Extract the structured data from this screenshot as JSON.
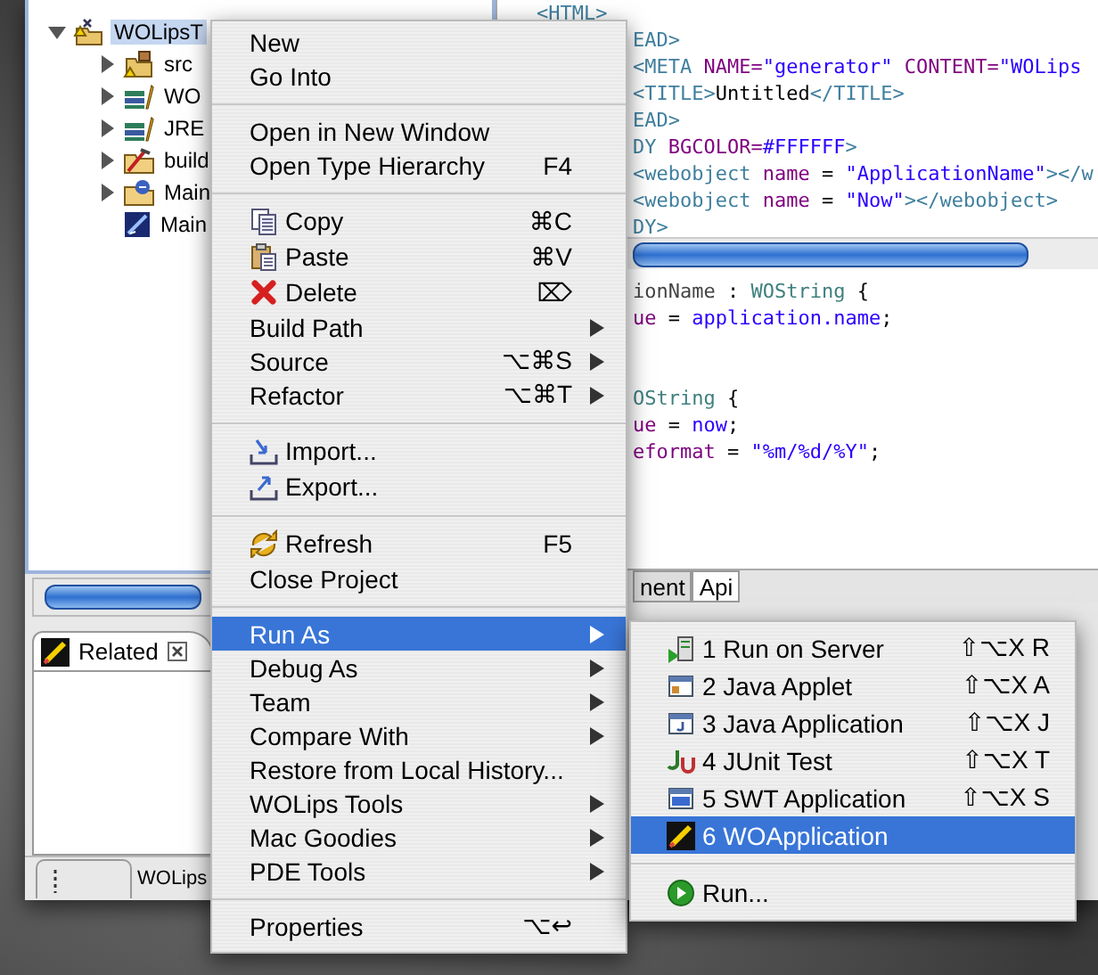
{
  "explorer": {
    "tree": {
      "label": "WOLipsT",
      "kind": "project",
      "expanded": true,
      "selected": true,
      "children": [
        {
          "label": "src",
          "kind": "source-folder",
          "expanded": false
        },
        {
          "label": "WO",
          "kind": "library",
          "expanded": false
        },
        {
          "label": "JRE",
          "kind": "library",
          "expanded": false
        },
        {
          "label": "build",
          "kind": "build-folder",
          "expanded": false
        },
        {
          "label": "Main",
          "kind": "component-folder",
          "expanded": false
        },
        {
          "label": "Main",
          "kind": "api-file"
        }
      ]
    }
  },
  "related_view": {
    "tab": {
      "label": "Related",
      "selected": true
    }
  },
  "status_bar": {
    "text": "WOLips"
  },
  "editor": {
    "html_lines": [
      [
        {
          "kind": "tag",
          "text": "<HTML>"
        }
      ],
      [
        {
          "kind": "tag",
          "text": "EAD>"
        }
      ],
      [
        {
          "kind": "tag",
          "text": "<META "
        },
        {
          "kind": "attr",
          "text": "NAME="
        },
        {
          "kind": "string",
          "text": "\"generator\""
        },
        {
          "kind": "attr",
          "text": " CONTENT="
        },
        {
          "kind": "string",
          "text": "\"WOLips"
        }
      ],
      [
        {
          "kind": "tag",
          "text": "<TITLE>"
        },
        {
          "kind": "plain",
          "text": "Untitled"
        },
        {
          "kind": "tag",
          "text": "</TITLE>"
        }
      ],
      [
        {
          "kind": "tag",
          "text": "EAD>"
        }
      ],
      [
        {
          "kind": "tag",
          "text": "DY "
        },
        {
          "kind": "attr",
          "text": "BGCOLOR="
        },
        {
          "kind": "string",
          "text": "#FFFFFF"
        },
        {
          "kind": "tag",
          "text": ">"
        }
      ],
      [
        {
          "kind": "tag",
          "text": "<webobject "
        },
        {
          "kind": "attr",
          "text": "name"
        },
        {
          "kind": "plain",
          "text": " = "
        },
        {
          "kind": "string",
          "text": "\"ApplicationName\""
        },
        {
          "kind": "tag",
          "text": "></w"
        }
      ],
      [
        {
          "kind": "tag",
          "text": "<webobject "
        },
        {
          "kind": "attr",
          "text": "name"
        },
        {
          "kind": "plain",
          "text": " = "
        },
        {
          "kind": "string",
          "text": "\"Now\""
        },
        {
          "kind": "tag",
          "text": "></webobject>"
        }
      ],
      [
        {
          "kind": "tag",
          "text": "DY>"
        }
      ]
    ],
    "bindings": [
      {
        "lines": [
          [
            {
              "kind": "key",
              "text": "ionName"
            },
            {
              "kind": "plain",
              "text": " : "
            },
            {
              "kind": "type",
              "text": "WOString"
            },
            {
              "kind": "plain",
              "text": " {"
            }
          ],
          [
            {
              "kind": "attr",
              "text": "ue"
            },
            {
              "kind": "plain",
              "text": " = "
            },
            {
              "kind": "string",
              "text": "application.name"
            },
            {
              "kind": "plain",
              "text": ";"
            }
          ]
        ]
      },
      {
        "lines": [
          [
            {
              "kind": "type",
              "text": "OString"
            },
            {
              "kind": "plain",
              "text": " {"
            }
          ],
          [
            {
              "kind": "attr",
              "text": "ue"
            },
            {
              "kind": "plain",
              "text": " = "
            },
            {
              "kind": "string",
              "text": "now"
            },
            {
              "kind": "plain",
              "text": ";"
            }
          ],
          [
            {
              "kind": "attr",
              "text": "eformat"
            },
            {
              "kind": "plain",
              "text": " = "
            },
            {
              "kind": "string",
              "text": "\"%m/%d/%Y\""
            },
            {
              "kind": "plain",
              "text": ";"
            }
          ]
        ]
      }
    ],
    "tabs": [
      {
        "label": "nent",
        "selected": false
      },
      {
        "label": "Api",
        "selected": true
      }
    ]
  },
  "context_menu": {
    "items": [
      {
        "kind": "item",
        "label": "New",
        "selected": false
      },
      {
        "kind": "item",
        "label": "Go Into",
        "selected": false
      },
      {
        "kind": "separator"
      },
      {
        "kind": "item",
        "label": "Open in New Window",
        "selected": false
      },
      {
        "kind": "item",
        "label": "Open Type Hierarchy",
        "shortcut": "F4",
        "selected": false
      },
      {
        "kind": "separator"
      },
      {
        "kind": "copy",
        "label": "Copy",
        "shortcut": "⌘C",
        "selected": false
      },
      {
        "kind": "paste",
        "label": "Paste",
        "shortcut": "⌘V",
        "selected": false
      },
      {
        "kind": "delete",
        "label": "Delete",
        "shortcut": "⌦",
        "selected": false
      },
      {
        "kind": "item",
        "label": "Build Path",
        "submenu": true,
        "selected": false
      },
      {
        "kind": "item",
        "label": "Source",
        "shortcut": "⌥⌘S",
        "submenu": true,
        "selected": false
      },
      {
        "kind": "item",
        "label": "Refactor",
        "shortcut": "⌥⌘T",
        "submenu": true,
        "selected": false
      },
      {
        "kind": "separator"
      },
      {
        "kind": "import",
        "label": "Import...",
        "selected": false
      },
      {
        "kind": "export",
        "label": "Export...",
        "selected": false
      },
      {
        "kind": "separator"
      },
      {
        "kind": "refresh",
        "label": "Refresh",
        "shortcut": "F5",
        "selected": false
      },
      {
        "kind": "item",
        "label": "Close Project",
        "selected": false
      },
      {
        "kind": "separator"
      },
      {
        "kind": "item",
        "label": "Run As",
        "submenu": true,
        "selected": true
      },
      {
        "kind": "item",
        "label": "Debug As",
        "submenu": true,
        "selected": false
      },
      {
        "kind": "item",
        "label": "Team",
        "submenu": true,
        "selected": false
      },
      {
        "kind": "item",
        "label": "Compare With",
        "submenu": true,
        "selected": false
      },
      {
        "kind": "item",
        "label": "Restore from Local History...",
        "selected": false
      },
      {
        "kind": "item",
        "label": "WOLips Tools",
        "submenu": true,
        "selected": false
      },
      {
        "kind": "item",
        "label": "Mac Goodies",
        "submenu": true,
        "selected": false
      },
      {
        "kind": "item",
        "label": "PDE Tools",
        "submenu": true,
        "selected": false
      },
      {
        "kind": "separator"
      },
      {
        "kind": "item",
        "label": "Properties",
        "shortcut": "⌥↩",
        "selected": false
      }
    ]
  },
  "run_as_menu": {
    "items": [
      {
        "kind": "server",
        "label": "1 Run on Server",
        "shortcut": "⇧⌥X R",
        "selected": false
      },
      {
        "kind": "applet",
        "label": "2 Java Applet",
        "shortcut": "⇧⌥X A",
        "selected": false
      },
      {
        "kind": "java-app",
        "label": "3 Java Application",
        "shortcut": "⇧⌥X J",
        "selected": false
      },
      {
        "kind": "junit",
        "label": "4 JUnit Test",
        "shortcut": "⇧⌥X T",
        "selected": false
      },
      {
        "kind": "swt",
        "label": "5 SWT Application",
        "shortcut": "⇧⌥X S",
        "selected": false
      },
      {
        "kind": "wo",
        "label": "6 WOApplication",
        "selected": true
      },
      {
        "kind": "separator"
      },
      {
        "kind": "run",
        "label": "Run...",
        "selected": false
      }
    ]
  }
}
